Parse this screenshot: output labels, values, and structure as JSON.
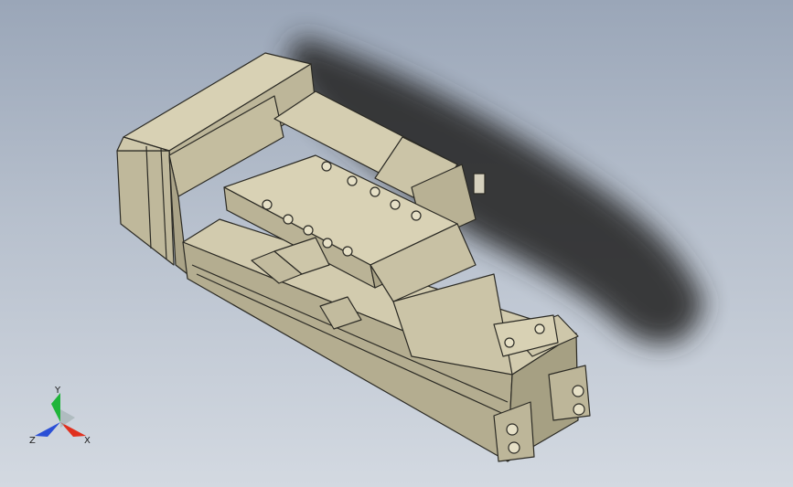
{
  "viewport": {
    "background_top": "#9aa6b8",
    "background_bottom": "#d3d9e1",
    "model_color": "#c9c2a5",
    "model_edge": "#2b2a24"
  },
  "triad": {
    "x_label": "X",
    "y_label": "Y",
    "z_label": "Z",
    "x_color": "#e0301e",
    "y_color": "#1fb53a",
    "z_color": "#2a4fd6"
  }
}
